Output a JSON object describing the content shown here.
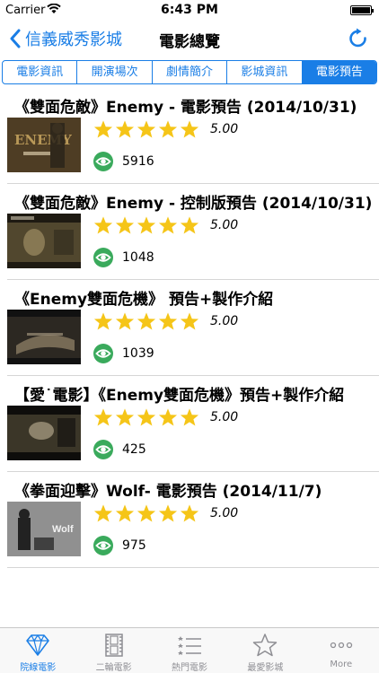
{
  "status_bar": {
    "carrier": "Carrier",
    "time": "6:43 PM"
  },
  "nav": {
    "back_label": "信義威秀影城",
    "title": "電影總覽"
  },
  "segments": [
    {
      "label": "電影資訊",
      "active": false
    },
    {
      "label": "開演場次",
      "active": false
    },
    {
      "label": "劇情簡介",
      "active": false
    },
    {
      "label": "影城資訊",
      "active": false
    },
    {
      "label": "電影預告",
      "active": true
    }
  ],
  "videos": [
    {
      "title": "《雙面危敵》Enemy - 電影預告 (2014/10/31)",
      "rating": "5.00",
      "stars": 5,
      "views": "5916"
    },
    {
      "title": "《雙面危敵》Enemy - 控制版預告 (2014/10/31)",
      "rating": "5.00",
      "stars": 5,
      "views": "1048"
    },
    {
      "title": "《Enemy雙面危機》 預告+製作介紹",
      "rating": "5.00",
      "stars": 5,
      "views": "1039"
    },
    {
      "title": "【愛˙電影】《Enemy雙面危機》預告+製作介紹",
      "rating": "5.00",
      "stars": 5,
      "views": "425"
    },
    {
      "title": "《拳面迎擊》Wolf- 電影預告 (2014/11/7)",
      "rating": "5.00",
      "stars": 5,
      "views": "975"
    }
  ],
  "tab_bar": {
    "items": [
      {
        "label": "院線電影",
        "icon": "diamond-icon",
        "active": true
      },
      {
        "label": "二輪電影",
        "icon": "film-icon",
        "active": false
      },
      {
        "label": "熱門電影",
        "icon": "ranked-list-icon",
        "active": false
      },
      {
        "label": "最愛影城",
        "icon": "star-outline-icon",
        "active": false
      },
      {
        "label": "More",
        "icon": "more-icon",
        "active": false
      }
    ]
  },
  "colors": {
    "accent": "#1a7ee6",
    "star": "#f5c518",
    "eye": "#3aaa5c"
  }
}
